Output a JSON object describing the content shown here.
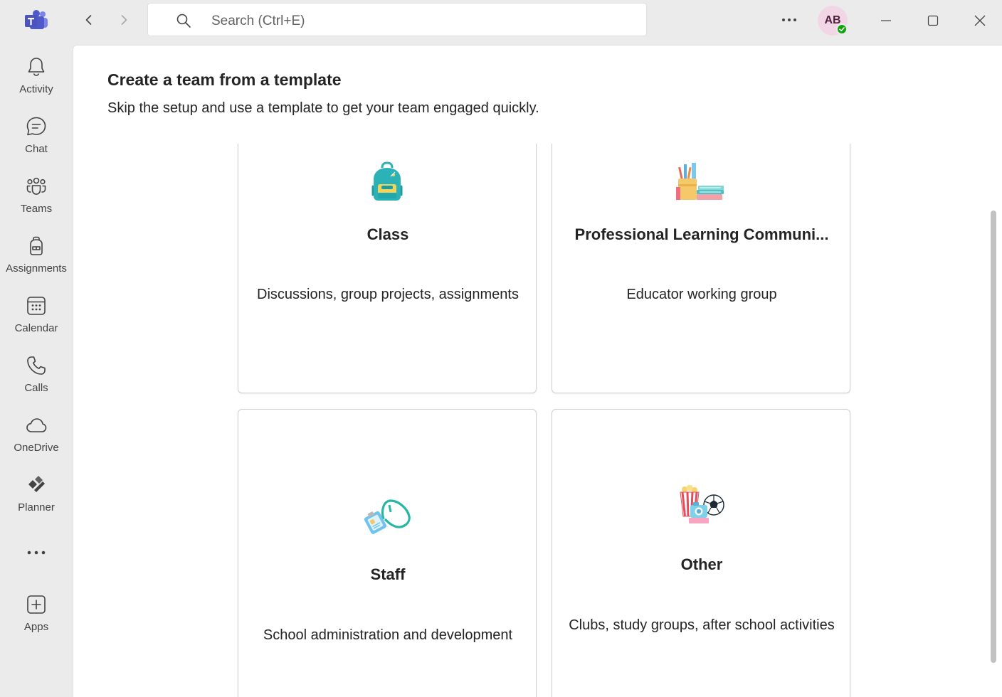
{
  "app": {
    "name": "Microsoft Teams",
    "logo_icon": "teams-logo-icon",
    "accent": "#5b5fc7"
  },
  "titlebar": {
    "search_placeholder": "Search (Ctrl+E)",
    "avatar_initials": "AB",
    "presence_status": "available",
    "presence_color": "#13a10e"
  },
  "rail": {
    "items": [
      {
        "label": "Activity",
        "icon": "bell-icon"
      },
      {
        "label": "Chat",
        "icon": "chat-icon"
      },
      {
        "label": "Teams",
        "icon": "teams-icon"
      },
      {
        "label": "Assignments",
        "icon": "backpack-icon"
      },
      {
        "label": "Calendar",
        "icon": "calendar-icon"
      },
      {
        "label": "Calls",
        "icon": "phone-icon"
      },
      {
        "label": "OneDrive",
        "icon": "cloud-icon"
      },
      {
        "label": "Planner",
        "icon": "planner-icon"
      }
    ],
    "apps_label": "Apps"
  },
  "main": {
    "title": "Create a team from a template",
    "subtitle": "Skip the setup and use a template to get your team engaged quickly.",
    "cards": [
      {
        "title": "Class",
        "description": "Discussions, group projects, assignments",
        "icon": "backpack-illustration-icon"
      },
      {
        "title": "Professional Learning Communi...",
        "description": "Educator working group",
        "icon": "pencil-cup-books-illustration-icon"
      },
      {
        "title": "Staff",
        "description": "School administration and development",
        "icon": "id-badge-lanyard-illustration-icon"
      },
      {
        "title": "Other",
        "description": "Clubs, study groups, after school activities",
        "icon": "popcorn-camera-ball-illustration-icon"
      }
    ]
  }
}
